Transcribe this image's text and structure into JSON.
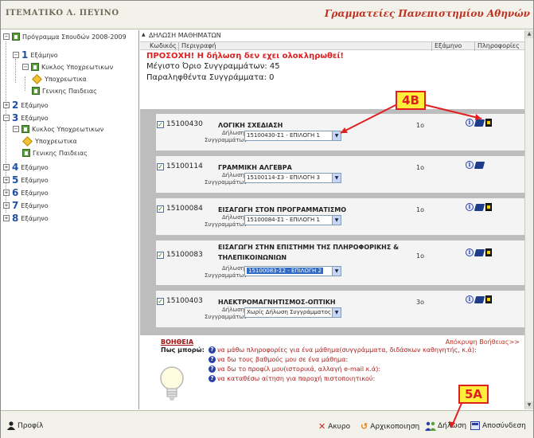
{
  "header": {
    "brand_left": "ΙΤΕΜΑΤΙΚΟ Λ. ΠΕΥΙΝΟ",
    "brand_right": "Γραμματείες Πανεπιστημίου Αθηνών"
  },
  "tree": {
    "root_label": "Πρόγραμμα Σπουδών 2008-2009",
    "semester_word": "Εξάμηνο",
    "branch_label": "Κυκλος Υποχρεωτικων",
    "leaf_required": "Υποχρεωτικα",
    "leaf_general": "Γενικης Παιδειας",
    "semesters": [
      {
        "num": "1"
      },
      {
        "num": "2"
      },
      {
        "num": "3"
      },
      {
        "num": "4"
      },
      {
        "num": "5"
      },
      {
        "num": "6"
      },
      {
        "num": "7"
      },
      {
        "num": "8"
      }
    ]
  },
  "section": {
    "title": "ΔΗΛΩΣΗ ΜΑΘΗΜΑΤΩΝ",
    "columns": {
      "code": "Κωδικός",
      "desc": "Περιγραφή",
      "semester": "Εξάμηνο",
      "info": "Πληροφορίες"
    },
    "warning": "ΠΡΟΣΟΧΗ! Η δήλωση δεν εχει ολοκληρωθεί!",
    "max_books": "Μέγιστο Όριο Συγγραμμάτων: 45",
    "received_books": "Παραληφθέντα Συγγράμματα: 0"
  },
  "course_labels": {
    "declaration": "Δήλωση",
    "books": "Συγγραμμάτων"
  },
  "courses": [
    {
      "code": "15100430",
      "name": "ΛΟΓΙΚΗ ΣΧΕΔΙΑΣΗ",
      "selection": "15100430-Σ1 - ΕΠΙΛΟΓΗ 1",
      "semester": "1ο",
      "checked": "✓"
    },
    {
      "code": "15100114",
      "name": "ΓΡΑΜΜΙΚΗ ΑΛΓΕΒΡΑ",
      "selection": "15100114-Σ3 - ΕΠΙΛΟΓΗ 3",
      "semester": "1ο",
      "checked": "✓"
    },
    {
      "code": "15100084",
      "name": "ΕΙΣΑΓΩΓΗ ΣΤΟΝ ΠΡΟΓΡΑΜΜΑΤΙΣΜΟ",
      "selection": "15100084-Σ1 - ΕΠΙΛΟΓΗ 1",
      "semester": "1ο",
      "checked": "✓"
    },
    {
      "code": "15100083",
      "name_line1": "ΕΙΣΑΓΩΓΗ ΣΤΗΝ ΕΠΙΣΤΗΜΗ ΤΗΣ ΠΛΗΡΟΦΟΡΙΚΗΣ &",
      "name_line2": "ΤΗΛΕΠΙΚΟΙΝΩΝΙΩΝ",
      "selection": "15100083-Σ2 - ΕΠΙΛΟΓΗ 2",
      "semester": "1ο",
      "checked": "✓"
    },
    {
      "code": "15100403",
      "name": "ΗΛΕΚΤΡΟΜΑΓΝΗΤΙΣΜΟΣ-ΟΠΤΙΚΗ",
      "selection": "Χωρίς Δήλωση Συγγράμματος",
      "semester": "3ο",
      "checked": "✓"
    }
  ],
  "help": {
    "title": "ΒΟΗΘΕΙΑ",
    "hide": "Απόκρυψη Βοήθειας>>",
    "lead": "Πως μπορώ:",
    "items": [
      "να μάθω πληροφορίες για ένα μάθημα(συγγράμματα, διδάσκων καθηγητής, κ.ά):",
      "να δω τους βαθμούς μου σε ένα μάθημα:",
      "να δω το προφίλ μου(ιστορικά, αλλαγή e-mail κ.ά):",
      "να καταθέσω αίτηση για παροχή πιστοποιητικού:"
    ]
  },
  "statusbar": {
    "profile": "Προφίλ",
    "cancel": "Ακυρο",
    "reset": "Αρχικοποιηση",
    "declare": "Δήλωση",
    "logout": "Αποσύνδεση"
  },
  "annotations": {
    "badge_4b": "4B",
    "badge_5a": "5A"
  },
  "colors": {
    "warning": "#e02020",
    "badge_fill": "#ffef3a",
    "badge_border": "#e02020",
    "selection": "#316ac5"
  }
}
